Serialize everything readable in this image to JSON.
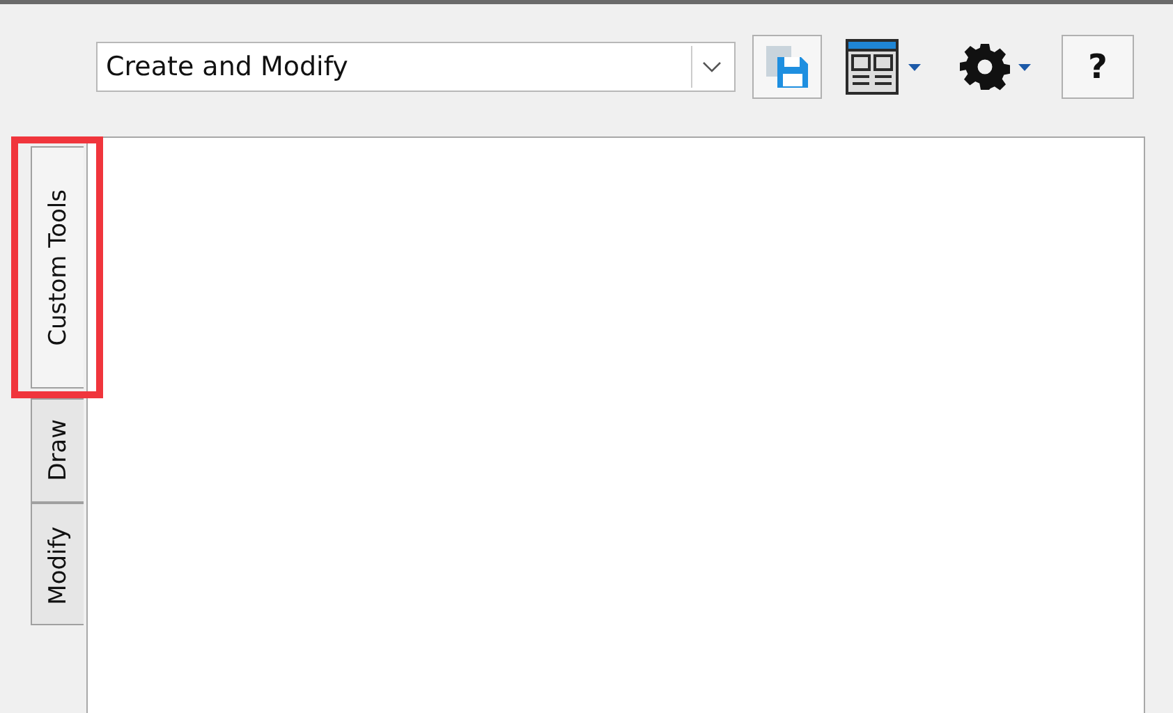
{
  "toolbar": {
    "palette_dropdown": {
      "value": "Create and Modify"
    },
    "help_button": {
      "label": "?"
    }
  },
  "side_tabs": [
    {
      "label": "Custom Tools",
      "selected": true,
      "highlighted": true
    },
    {
      "label": "Draw",
      "selected": false,
      "highlighted": false
    },
    {
      "label": "Modify",
      "selected": false,
      "highlighted": false
    }
  ]
}
